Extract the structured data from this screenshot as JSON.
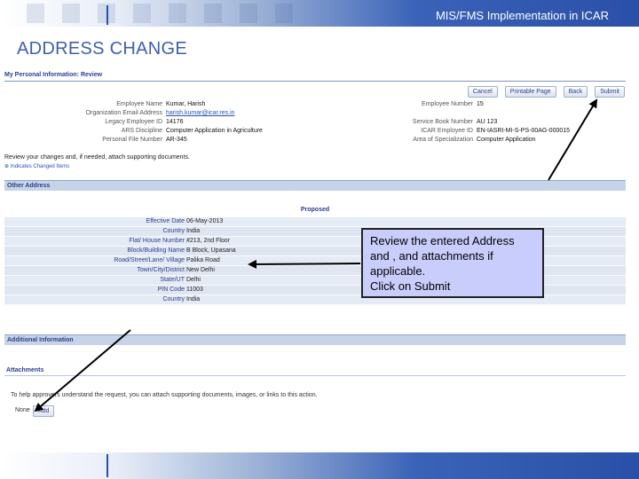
{
  "slide": {
    "header_title": "MIS/FMS Implementation in ICAR",
    "title": "ADDRESS CHANGE"
  },
  "page": {
    "title": "My Personal Information: Review",
    "buttons": {
      "cancel": "Cancel",
      "printable": "Printable Page",
      "back": "Back",
      "submit": "Submit"
    },
    "left_info": [
      {
        "label": "Employee Name",
        "value": "Kumar, Harish"
      },
      {
        "label": "Organization Email Address",
        "value": "harish.kumar@icar.res.in"
      },
      {
        "label": "Legacy Employee ID",
        "value": "14176"
      },
      {
        "label": "ARS Discipline",
        "value": "Computer Application in Agriculture"
      },
      {
        "label": "Personal File Number",
        "value": "AR-345"
      }
    ],
    "right_info": [
      {
        "label": "Employee Number",
        "value": "15"
      },
      {
        "label": "Service Book Number",
        "value": "AU 123"
      },
      {
        "label": "ICAR Employee ID",
        "value": "EN-IASRI-MI-S-PS-00AG-000015"
      },
      {
        "label": "Area of Specialization",
        "value": "Computer Application"
      }
    ],
    "instruction": "Review your changes and, if needed, attach supporting documents.",
    "legend": "Indicates Changed Items",
    "other_address": {
      "heading": "Other Address",
      "column": "Proposed",
      "rows": [
        {
          "label": "Effective Date",
          "value": "06-May-2013"
        },
        {
          "label": "Country",
          "value": "India"
        },
        {
          "label": "Flat/ House Number",
          "value": "#213, 2nd Floor"
        },
        {
          "label": "Block/Building Name",
          "value": "B Block, Upasana"
        },
        {
          "label": "Road/Street/Lane/ Village",
          "value": "Palika Road"
        },
        {
          "label": "Town/City/District",
          "value": "New Delhi"
        },
        {
          "label": "State/UT",
          "value": "Delhi"
        },
        {
          "label": "PIN Code",
          "value": "11003"
        },
        {
          "label": "Country",
          "value": "India"
        }
      ]
    },
    "additional_info": {
      "heading": "Additional Information"
    },
    "attachments": {
      "title": "Attachments",
      "help": "To help approvers understand the request, you can attach supporting documents, images, or links to this action.",
      "none": "None",
      "add": "Add"
    }
  },
  "callout": {
    "line1": "Review the entered Address",
    "line2": "and , and attachments if",
    "line3": "applicable.",
    "line4": "Click on Submit"
  }
}
